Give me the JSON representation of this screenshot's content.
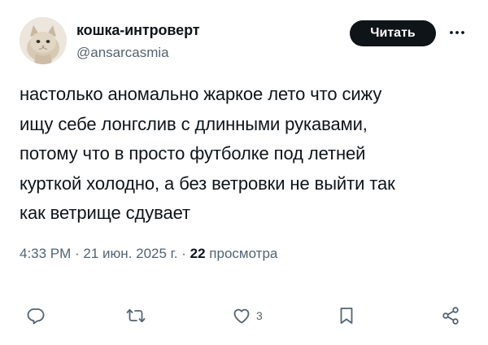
{
  "author": {
    "display_name": "кошка-интроверт",
    "handle": "@ansarcasmia"
  },
  "follow_button": {
    "label": "Читать"
  },
  "tweet": {
    "lines": [
      "настолько аномально жаркое лето что сижу",
      "ищу себе лонгслив с длинными рукавами,",
      "потому что в просто футболке под летней",
      "курткой холодно, а без ветровки не выйти так",
      "как ветрище сдувает"
    ]
  },
  "meta": {
    "time": "4:33 PM",
    "separator": " · ",
    "date": "21 июн. 2025 г.",
    "views_count": "22",
    "views_label": "просмотра"
  },
  "actions": {
    "reply": {
      "icon": "reply-icon"
    },
    "repost": {
      "icon": "repost-icon"
    },
    "like": {
      "icon": "heart-icon",
      "count": "3"
    },
    "bookmark": {
      "icon": "bookmark-icon"
    },
    "share": {
      "icon": "share-icon"
    }
  },
  "colors": {
    "text_primary": "#0f1419",
    "text_secondary": "#536471",
    "button_bg": "#0f1419",
    "button_text": "#ffffff"
  }
}
